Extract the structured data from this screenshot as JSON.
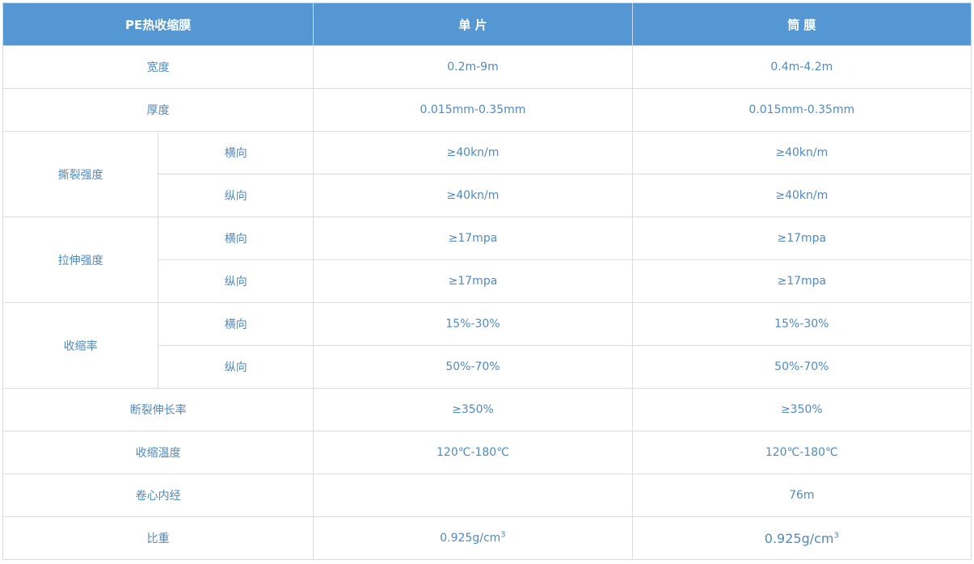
{
  "header": {
    "col_property": "PE热收缩膜",
    "col_single": "单 片",
    "col_tube": "筒 膜"
  },
  "rows": {
    "width": {
      "label": "宽度",
      "single": "0.2m-9m",
      "tube": "0.4m-4.2m"
    },
    "thickness": {
      "label": "厚度",
      "single": "0.015mm-0.35mm",
      "tube": "0.015mm-0.35mm"
    },
    "tear": {
      "label": "撕裂强度",
      "transverse": {
        "label": "横向",
        "single": "≥40kn/m",
        "tube": "≥40kn/m"
      },
      "longitudinal": {
        "label": "纵向",
        "single": "≥40kn/m",
        "tube": "≥40kn/m"
      }
    },
    "tensile": {
      "label": "拉伸强度",
      "transverse": {
        "label": "横向",
        "single": "≥17mpa",
        "tube": "≥17mpa"
      },
      "longitudinal": {
        "label": "纵向",
        "single": "≥17mpa",
        "tube": "≥17mpa"
      }
    },
    "shrink": {
      "label": "收缩率",
      "transverse": {
        "label": "横向",
        "single": "15%-30%",
        "tube": "15%-30%"
      },
      "longitudinal": {
        "label": "纵向",
        "single": "50%-70%",
        "tube": "50%-70%"
      }
    },
    "elongation": {
      "label": "断裂伸长率",
      "single": "≥350%",
      "tube": "≥350%"
    },
    "shrink_temp": {
      "label": "收缩温度",
      "single": "120℃-180℃",
      "tube": "120℃-180℃"
    },
    "core": {
      "label": "卷心内经",
      "single": "",
      "tube": "76m"
    },
    "density": {
      "label": "比重",
      "single": "0.925g/cm",
      "single_sup": "3",
      "tube": "0.925g/cm",
      "tube_sup": "3"
    }
  }
}
